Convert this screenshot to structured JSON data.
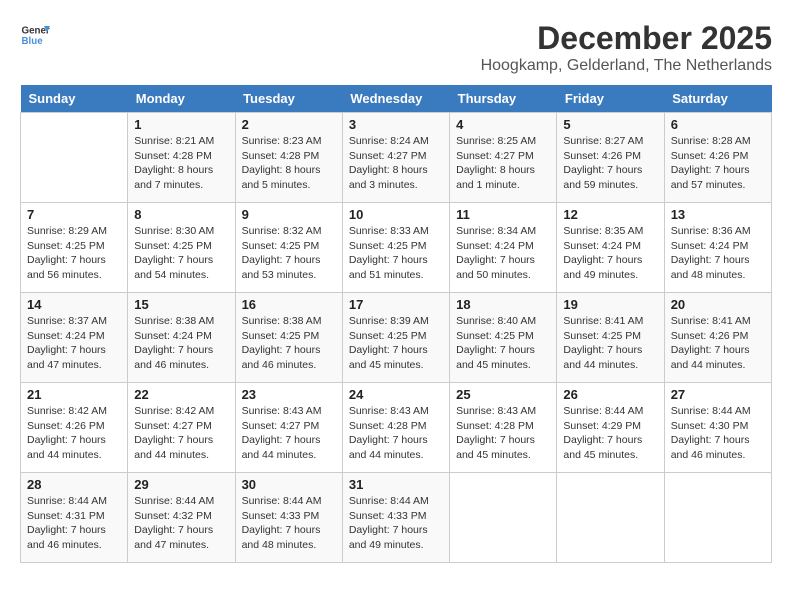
{
  "logo": {
    "text_general": "General",
    "text_blue": "Blue"
  },
  "title": {
    "month": "December 2025",
    "location": "Hoogkamp, Gelderland, The Netherlands"
  },
  "headers": [
    "Sunday",
    "Monday",
    "Tuesday",
    "Wednesday",
    "Thursday",
    "Friday",
    "Saturday"
  ],
  "weeks": [
    [
      {
        "day": "",
        "info": ""
      },
      {
        "day": "1",
        "info": "Sunrise: 8:21 AM\nSunset: 4:28 PM\nDaylight: 8 hours\nand 7 minutes."
      },
      {
        "day": "2",
        "info": "Sunrise: 8:23 AM\nSunset: 4:28 PM\nDaylight: 8 hours\nand 5 minutes."
      },
      {
        "day": "3",
        "info": "Sunrise: 8:24 AM\nSunset: 4:27 PM\nDaylight: 8 hours\nand 3 minutes."
      },
      {
        "day": "4",
        "info": "Sunrise: 8:25 AM\nSunset: 4:27 PM\nDaylight: 8 hours\nand 1 minute."
      },
      {
        "day": "5",
        "info": "Sunrise: 8:27 AM\nSunset: 4:26 PM\nDaylight: 7 hours\nand 59 minutes."
      },
      {
        "day": "6",
        "info": "Sunrise: 8:28 AM\nSunset: 4:26 PM\nDaylight: 7 hours\nand 57 minutes."
      }
    ],
    [
      {
        "day": "7",
        "info": "Sunrise: 8:29 AM\nSunset: 4:25 PM\nDaylight: 7 hours\nand 56 minutes."
      },
      {
        "day": "8",
        "info": "Sunrise: 8:30 AM\nSunset: 4:25 PM\nDaylight: 7 hours\nand 54 minutes."
      },
      {
        "day": "9",
        "info": "Sunrise: 8:32 AM\nSunset: 4:25 PM\nDaylight: 7 hours\nand 53 minutes."
      },
      {
        "day": "10",
        "info": "Sunrise: 8:33 AM\nSunset: 4:25 PM\nDaylight: 7 hours\nand 51 minutes."
      },
      {
        "day": "11",
        "info": "Sunrise: 8:34 AM\nSunset: 4:24 PM\nDaylight: 7 hours\nand 50 minutes."
      },
      {
        "day": "12",
        "info": "Sunrise: 8:35 AM\nSunset: 4:24 PM\nDaylight: 7 hours\nand 49 minutes."
      },
      {
        "day": "13",
        "info": "Sunrise: 8:36 AM\nSunset: 4:24 PM\nDaylight: 7 hours\nand 48 minutes."
      }
    ],
    [
      {
        "day": "14",
        "info": "Sunrise: 8:37 AM\nSunset: 4:24 PM\nDaylight: 7 hours\nand 47 minutes."
      },
      {
        "day": "15",
        "info": "Sunrise: 8:38 AM\nSunset: 4:24 PM\nDaylight: 7 hours\nand 46 minutes."
      },
      {
        "day": "16",
        "info": "Sunrise: 8:38 AM\nSunset: 4:25 PM\nDaylight: 7 hours\nand 46 minutes."
      },
      {
        "day": "17",
        "info": "Sunrise: 8:39 AM\nSunset: 4:25 PM\nDaylight: 7 hours\nand 45 minutes."
      },
      {
        "day": "18",
        "info": "Sunrise: 8:40 AM\nSunset: 4:25 PM\nDaylight: 7 hours\nand 45 minutes."
      },
      {
        "day": "19",
        "info": "Sunrise: 8:41 AM\nSunset: 4:25 PM\nDaylight: 7 hours\nand 44 minutes."
      },
      {
        "day": "20",
        "info": "Sunrise: 8:41 AM\nSunset: 4:26 PM\nDaylight: 7 hours\nand 44 minutes."
      }
    ],
    [
      {
        "day": "21",
        "info": "Sunrise: 8:42 AM\nSunset: 4:26 PM\nDaylight: 7 hours\nand 44 minutes."
      },
      {
        "day": "22",
        "info": "Sunrise: 8:42 AM\nSunset: 4:27 PM\nDaylight: 7 hours\nand 44 minutes."
      },
      {
        "day": "23",
        "info": "Sunrise: 8:43 AM\nSunset: 4:27 PM\nDaylight: 7 hours\nand 44 minutes."
      },
      {
        "day": "24",
        "info": "Sunrise: 8:43 AM\nSunset: 4:28 PM\nDaylight: 7 hours\nand 44 minutes."
      },
      {
        "day": "25",
        "info": "Sunrise: 8:43 AM\nSunset: 4:28 PM\nDaylight: 7 hours\nand 45 minutes."
      },
      {
        "day": "26",
        "info": "Sunrise: 8:44 AM\nSunset: 4:29 PM\nDaylight: 7 hours\nand 45 minutes."
      },
      {
        "day": "27",
        "info": "Sunrise: 8:44 AM\nSunset: 4:30 PM\nDaylight: 7 hours\nand 46 minutes."
      }
    ],
    [
      {
        "day": "28",
        "info": "Sunrise: 8:44 AM\nSunset: 4:31 PM\nDaylight: 7 hours\nand 46 minutes."
      },
      {
        "day": "29",
        "info": "Sunrise: 8:44 AM\nSunset: 4:32 PM\nDaylight: 7 hours\nand 47 minutes."
      },
      {
        "day": "30",
        "info": "Sunrise: 8:44 AM\nSunset: 4:33 PM\nDaylight: 7 hours\nand 48 minutes."
      },
      {
        "day": "31",
        "info": "Sunrise: 8:44 AM\nSunset: 4:33 PM\nDaylight: 7 hours\nand 49 minutes."
      },
      {
        "day": "",
        "info": ""
      },
      {
        "day": "",
        "info": ""
      },
      {
        "day": "",
        "info": ""
      }
    ]
  ]
}
